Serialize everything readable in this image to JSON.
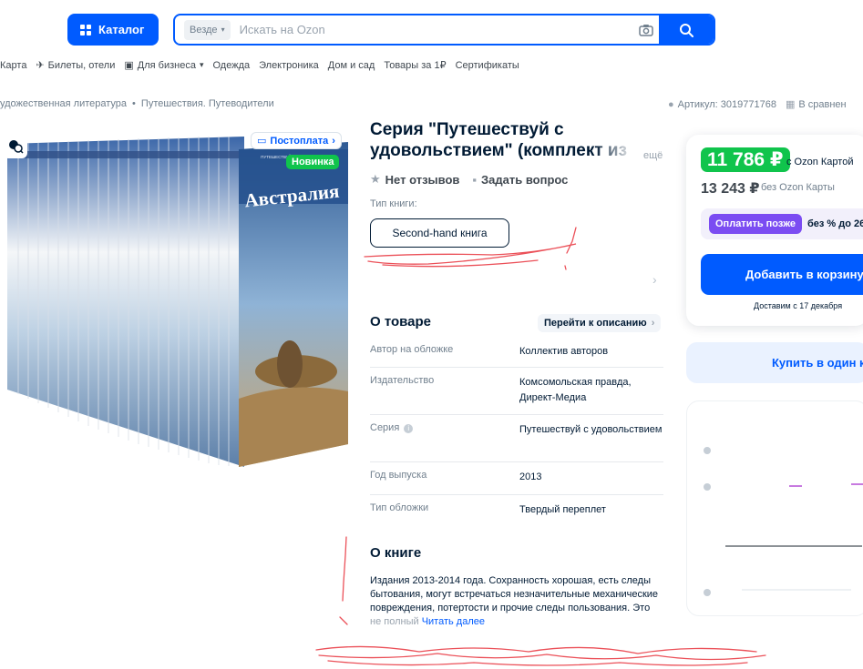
{
  "header": {
    "catalog_label": "Каталог",
    "search_scope": "Везде",
    "search_placeholder": "Искать на Ozon"
  },
  "topnav": [
    "Карта",
    "Билеты, отели",
    "Для бизнеса",
    "Одежда",
    "Электроника",
    "Дом и сад",
    "Товары за 1₽",
    "Сертификаты"
  ],
  "breadcrumbs": [
    "удожественная литература",
    "•",
    "Путешествия. Путеводители"
  ],
  "artikul": {
    "label": "Артикул: 3019771768",
    "compare": "В сравнен"
  },
  "image": {
    "badge_postpay": "Постоплата",
    "badge_new": "Новинка",
    "cover_title": "Австралия",
    "cover_subtitle": "ПУТЕШЕСТВУЙ С УДОВОЛЬСТВИЕМ"
  },
  "product": {
    "title_line1": "Серия \"Путешествуй с",
    "title_line2": "удовольствием\" (комплект из",
    "more": "ещё",
    "reviews": "Нет отзывов",
    "ask": "Задать вопрос",
    "book_type_label": "Тип книги:",
    "book_type_value": "Second-hand книга"
  },
  "about": {
    "title": "О товаре",
    "to_description": "Перейти к описанию",
    "specs": [
      {
        "k": "Автор на обложке",
        "v": "Коллектив авторов"
      },
      {
        "k": "Издательство",
        "v": "Комсомольская правда, Директ-Медиа"
      },
      {
        "k": "Серия",
        "v": "Путешествуй с удовольствием"
      },
      {
        "k": "Год выпуска",
        "v": "2013"
      },
      {
        "k": "Тип обложки",
        "v": "Твердый переплет"
      }
    ]
  },
  "book": {
    "title": "О книге",
    "text": "Издания 2013-2014 года. Сохранность хорошая, есть следы бытования, могут встречаться незначительные механические повреждения, потертости и прочие следы пользования. Это ",
    "faded": "не полный",
    "read_more": "Читать далее"
  },
  "price": {
    "card_price": "11 786 ₽",
    "card_caption": "с Ozon Картой",
    "regular_price": "13 243 ₽",
    "regular_caption": "без Ozon Карты",
    "pay_later": "Оплатить позже",
    "pay_later_caption": "без % до 26",
    "add_to_cart": "Добавить в корзину",
    "delivery": "Доставим с 17 декабря",
    "one_click": "Купить в один к"
  },
  "colors": {
    "brand": "#005bff",
    "green": "#10c44c",
    "purple": "#7b4cf2",
    "annotation": "#e8323c"
  }
}
